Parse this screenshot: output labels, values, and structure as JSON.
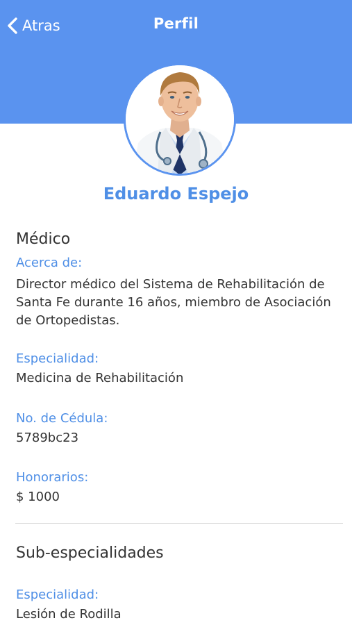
{
  "nav": {
    "back_label": "Atras",
    "title": "Perfil"
  },
  "profile": {
    "name": "Eduardo Espejo"
  },
  "medico": {
    "section_title": "Médico",
    "about_label": "Acerca de:",
    "about_value": "Director médico del Sistema de Rehabilitación de Santa Fe durante 16 años, miembro de Asociación de Ortopedistas.",
    "specialty_label": "Especialidad:",
    "specialty_value": "Medicina de Rehabilitación",
    "license_label": "No. de Cédula:",
    "license_value": "5789bc23",
    "fees_label": "Honorarios:",
    "fees_value": "$ 1000"
  },
  "sub_specialties": {
    "section_title": "Sub-especialidades",
    "specialty_label": "Especialidad:",
    "specialty_value": "Lesión de Rodilla"
  },
  "colors": {
    "header": "#5a93ef",
    "accent_text": "#4f8fe6",
    "body_text": "#333333"
  }
}
